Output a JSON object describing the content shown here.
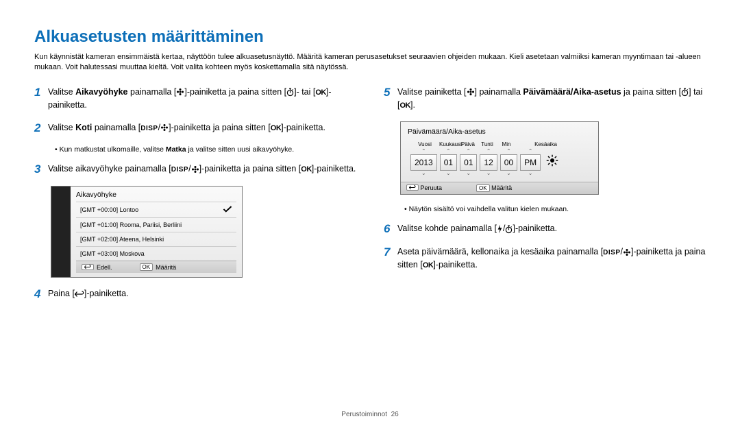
{
  "title": "Alkuasetusten määrittäminen",
  "intro": "Kun käynnistät kameran ensimmäistä kertaa, näyttöön tulee alkuasetusnäyttö. Määritä kameran perusasetukset seuraavien ohjeiden mukaan. Kieli asetetaan valmiiksi kameran myyntimaan tai -alueen mukaan. Voit halutessasi muuttaa kieltä. Voit valita kohteen myös koskettamalla sitä näytössä.",
  "steps": {
    "1a": "Valitse ",
    "1b": "Aikavyöhyke",
    "1c": " painamalla [",
    "1d": "]-painiketta ja paina sitten [",
    "1e": "]- tai [",
    "1f": "]-painiketta.",
    "2a": "Valitse ",
    "2b": "Koti",
    "2c": " painamalla [",
    "2d": "]-painiketta ja paina sitten [",
    "2e": "]-painiketta.",
    "2note": "Kun matkustat ulkomaille, valitse ",
    "2note_b": "Matka",
    "2note2": " ja valitse sitten uusi aikavyöhyke.",
    "3a": "Valitse aikavyöhyke painamalla [",
    "3b": "]-painiketta ja paina sitten [",
    "3c": "]-painiketta.",
    "4a": "Paina [",
    "4b": "]-painiketta.",
    "5a": "Valitse painiketta [",
    "5b": "] painamalla ",
    "5c": "Päivämäärä/Aika-asetus",
    "5d": " ja paina sitten [",
    "5e": "] tai [",
    "5f": "].",
    "5note": "Näytön sisältö voi vaihdella valitun kielen mukaan.",
    "6a": "Valitse kohde painamalla [",
    "6b": "]-painiketta.",
    "7a": "Aseta päivämäärä, kellonaika ja kesäaika painamalla [",
    "7b": "]-painiketta ja paina sitten [",
    "7c": "]-painiketta."
  },
  "tz_panel": {
    "title": "Aikavyöhyke",
    "items": [
      "[GMT +00:00] Lontoo",
      "[GMT +01:00] Rooma, Pariisi, Berliini",
      "[GMT +02:00] Ateena, Helsinki",
      "[GMT +03:00] Moskova"
    ],
    "back": "Edell.",
    "set": "Määritä"
  },
  "dt_panel": {
    "title": "Päivämäärä/Aika-asetus",
    "labels": {
      "year": "Vuosi",
      "month": "Kuukausi",
      "day": "Päivä",
      "hour": "Tunti",
      "min": "Min",
      "dst": "Kesäaika"
    },
    "values": {
      "year": "2013",
      "month": "01",
      "day": "01",
      "hour": "12",
      "min": "00",
      "ampm": "PM"
    },
    "cancel": "Peruuta",
    "set": "Määritä"
  },
  "icons": {
    "disp": "DISP",
    "ok": "OK"
  },
  "footer": {
    "section": "Perustoiminnot",
    "page": "26"
  }
}
